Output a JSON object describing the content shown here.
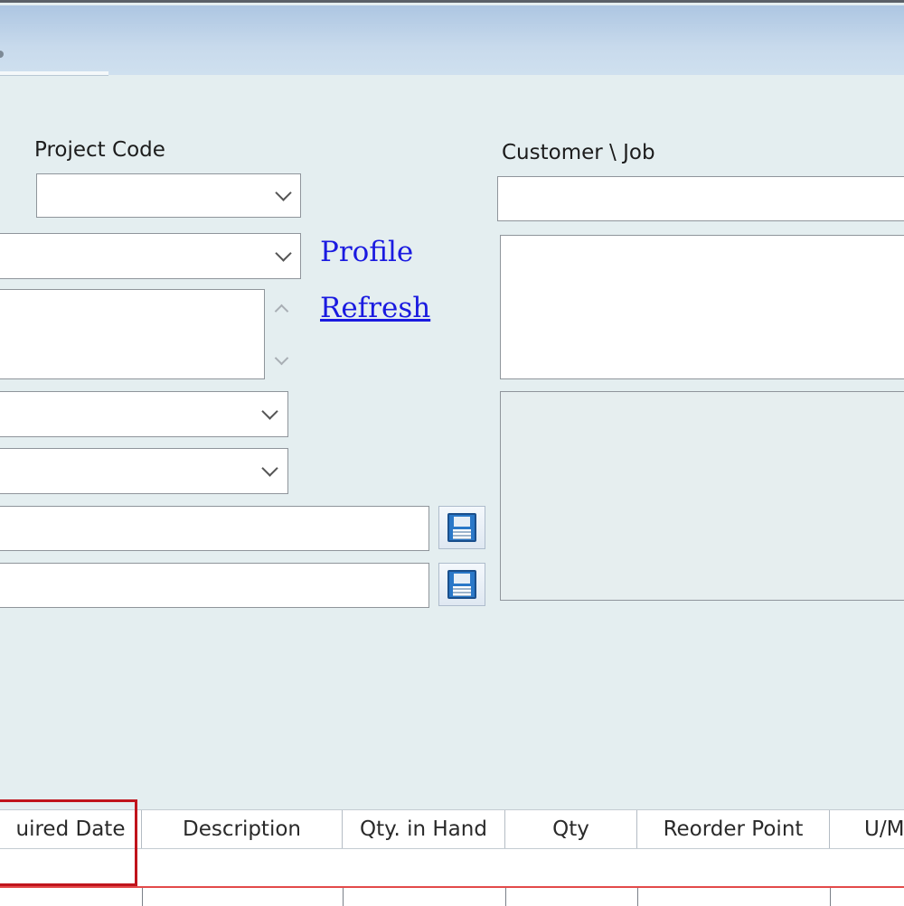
{
  "form": {
    "project_code_label": "Project Code",
    "customer_job_label": "Customer \\ Job",
    "profile_link": "Profile",
    "refresh_link": "Refresh"
  },
  "grid": {
    "columns": [
      "uired Date",
      "Description",
      "Qty. in Hand",
      "Qty",
      "Reorder Point",
      "U/M"
    ]
  },
  "icons": {
    "save": "floppy-disk-icon",
    "dropdown": "chevron-down-icon"
  },
  "colors": {
    "link": "#1a1ae0",
    "highlight": "#c0141c",
    "row_separator": "#e34a4a",
    "title_bar": "#b8cfe6"
  }
}
